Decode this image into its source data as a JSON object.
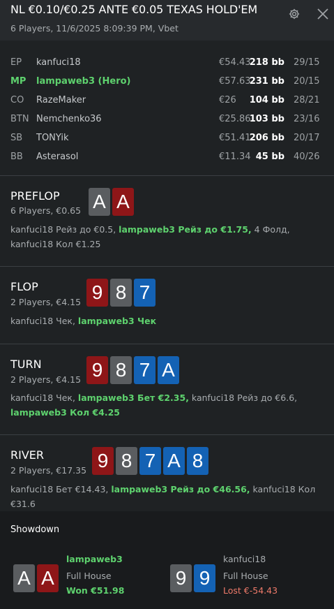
{
  "header": {
    "title": "NL €0.10/€0.25 ANTE €0.05 TEXAS HOLD'EM",
    "subtitle": "6 Players, 11/6/2025 8:09:39 PM, Vbet",
    "gear_icon": "gear-icon",
    "close_icon": "close-icon"
  },
  "players": [
    {
      "pos": "EP",
      "name": "kanfuci18",
      "stack": "€54.43",
      "bb": "218 bb",
      "stats": "29/15"
    },
    {
      "pos": "MP",
      "name": "lampaweb3 (Hero)",
      "stack": "€57.63",
      "bb": "231 bb",
      "stats": "20/15"
    },
    {
      "pos": "CO",
      "name": "RazeMaker",
      "stack": "€26",
      "bb": "104 bb",
      "stats": "28/21"
    },
    {
      "pos": "BTN",
      "name": "Nemchenko36",
      "stack": "€25.86",
      "bb": "103 bb",
      "stats": "23/16"
    },
    {
      "pos": "SB",
      "name": "TONYik",
      "stack": "€51.41",
      "bb": "206 bb",
      "stats": "20/17"
    },
    {
      "pos": "BB",
      "name": "Asterasol",
      "stack": "€11.34",
      "bb": "45 bb",
      "stats": "40/26"
    }
  ],
  "streets": {
    "preflop": {
      "name": "PREFLOP",
      "info": "6 Players, €0.65",
      "cards": [
        "A",
        "A"
      ],
      "actions": [
        {
          "text": "kanfuci18 Рейз до €0.5, ",
          "hero": false
        },
        {
          "text": "lampaweb3 Рейз до €1.75,",
          "hero": true
        },
        {
          "text": " 4 Фолд, kanfuci18 Кол €1.25",
          "hero": false
        }
      ]
    },
    "flop": {
      "name": "FLOP",
      "info": "2 Players, €4.15",
      "cards": [
        "9",
        "8",
        "7"
      ],
      "actions": [
        {
          "text": "kanfuci18 Чек, ",
          "hero": false
        },
        {
          "text": "lampaweb3 Чек",
          "hero": true
        }
      ]
    },
    "turn": {
      "name": "TURN",
      "info": "2 Players, €4.15",
      "cards": [
        "9",
        "8",
        "7",
        "A"
      ],
      "actions": [
        {
          "text": "kanfuci18 Чек, ",
          "hero": false
        },
        {
          "text": "lampaweb3 Бет €2.35,",
          "hero": true
        },
        {
          "text": " kanfuci18 Рейз до €6.6, ",
          "hero": false
        },
        {
          "text": "lampaweb3 Кол €4.25",
          "hero": true
        }
      ]
    },
    "river": {
      "name": "RIVER",
      "info": "2 Players, €17.35",
      "cards": [
        "9",
        "8",
        "7",
        "A",
        "8"
      ],
      "actions": [
        {
          "text": "kanfuci18 Бет €14.43, ",
          "hero": false
        },
        {
          "text": "lampaweb3 Рейз до €46.56,",
          "hero": true
        },
        {
          "text": " kanfuci18 Кол €31.6",
          "hero": false
        }
      ]
    }
  },
  "showdown": {
    "title": "Showdown",
    "hero": {
      "name": "lampaweb3",
      "hand": "Full House",
      "result": "Won €51.98",
      "cards": [
        "A",
        "A"
      ]
    },
    "villain": {
      "name": "kanfuci18",
      "hand": "Full House",
      "result": "Lost €-54.43",
      "cards": [
        "9",
        "9"
      ]
    }
  },
  "colors": {
    "hero_green": "#5ed26e",
    "loss_red": "#ef7a6a",
    "card_red": "#8e1618",
    "card_grey": "#5a5d60",
    "card_blue": "#1462b4"
  }
}
